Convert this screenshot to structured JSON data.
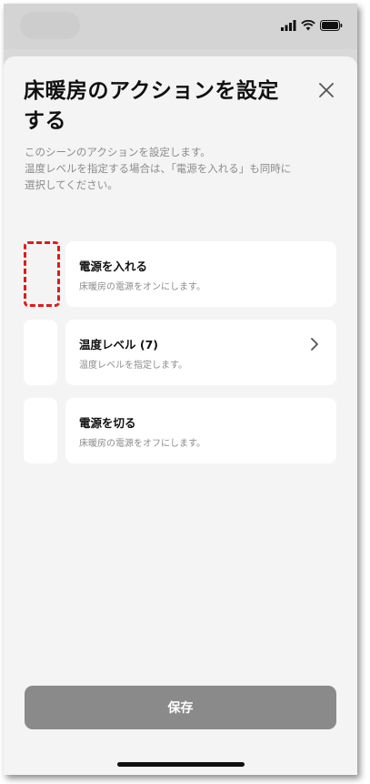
{
  "header": {
    "title_line1": "床暖房のアクションを設定",
    "title_line2": "する",
    "close_icon": "close-icon"
  },
  "description": {
    "line1": "このシーンのアクションを設定します。",
    "line2": "温度レベルを指定する場合は、「電源を入れる」も同時に",
    "line3": "選択してください。"
  },
  "actions": [
    {
      "title": "電源を入れる",
      "subtitle": "床暖房の電源をオンにします。",
      "highlighted": true
    },
    {
      "title": "温度レベル (7)",
      "subtitle": "温度レベルを指定します。",
      "has_chevron": true
    },
    {
      "title": "電源を切る",
      "subtitle": "床暖房の電源をオフにします。"
    }
  ],
  "footer": {
    "save_label": "保存"
  },
  "colors": {
    "highlight_dashed": "#e21a1a",
    "save_button": "#8a8a8a",
    "sheet_background": "#f4f4f4"
  }
}
